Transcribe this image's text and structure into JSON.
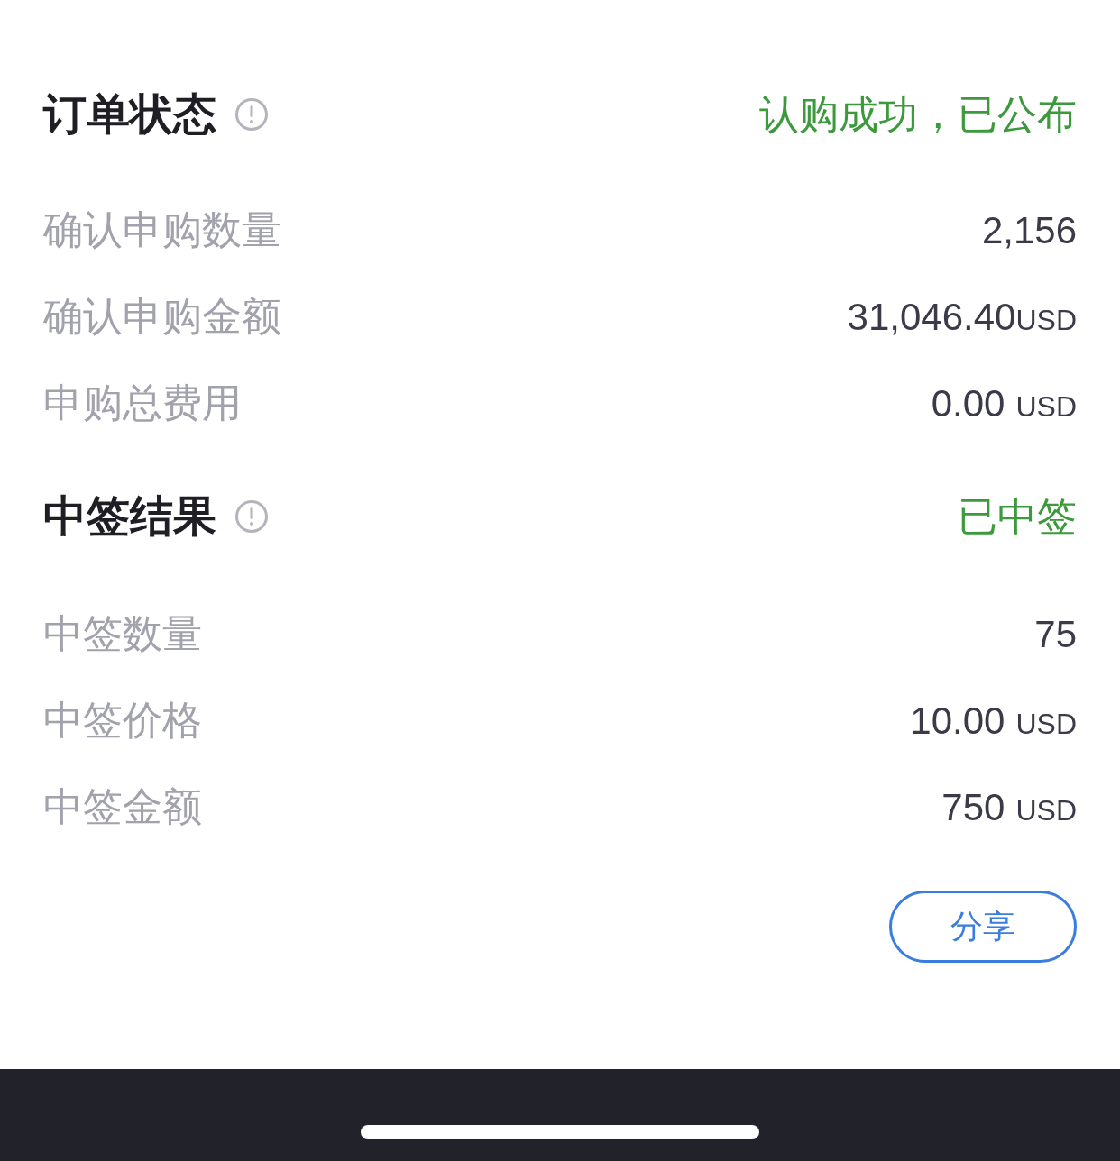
{
  "sections": [
    {
      "title": "订单状态",
      "status": "认购成功，已公布",
      "rows": [
        {
          "label": "确认申购数量",
          "value": "2,156"
        },
        {
          "label": "确认申购金额",
          "value": "31,046.40",
          "unit": "USD",
          "spaced": false
        },
        {
          "label": "申购总费用",
          "value": "0.00",
          "unit": "USD",
          "spaced": true
        }
      ]
    },
    {
      "title": "中签结果",
      "status": "已中签",
      "rows": [
        {
          "label": "中签数量",
          "value": "75"
        },
        {
          "label": "中签价格",
          "value": "10.00",
          "unit": "USD",
          "spaced": true
        },
        {
          "label": "中签金额",
          "value": "750",
          "unit": "USD",
          "spaced": true
        }
      ]
    }
  ],
  "share_button": "分享"
}
